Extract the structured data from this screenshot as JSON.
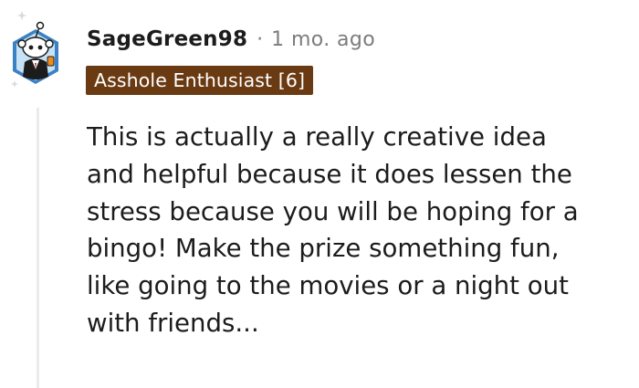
{
  "comment": {
    "username": "SageGreen98",
    "separator": "·",
    "timestamp": "1 mo. ago",
    "flair": "Asshole Enthusiast [6]",
    "flair_color": "#6a3a12",
    "body_lines": [
      "This is actually a really creative idea",
      "and helpful because it does lessen the",
      "stress because you will be hoping for a",
      "bingo! Make the prize something fun,",
      "like going to the movies or a night out",
      "with friends..."
    ]
  },
  "avatar": {
    "icon": "snoo-avatar-icon",
    "frame_color": "#3b82c4"
  }
}
